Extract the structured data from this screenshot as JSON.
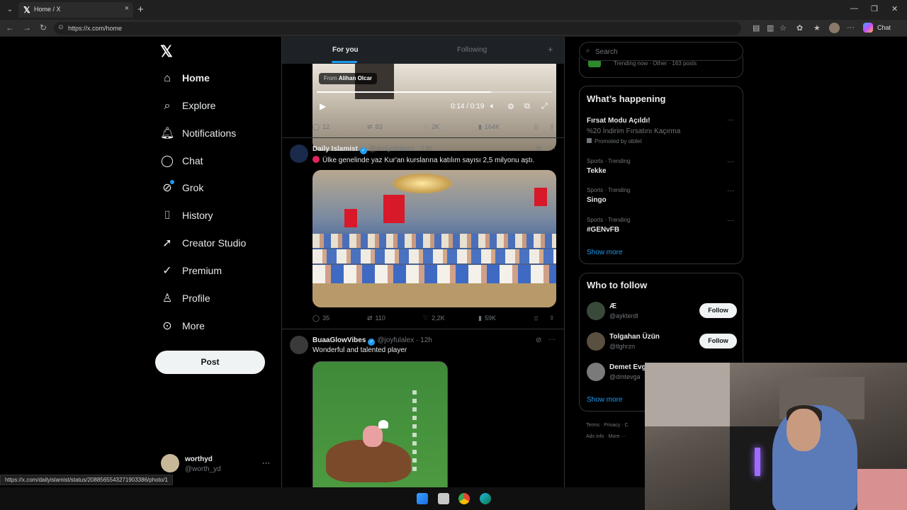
{
  "browser": {
    "tab_title": "Home / X",
    "url": "https://x.com/home",
    "chat_label": "Chat",
    "status_url": "https://x.com/dailyislamist/status/2088565543271903386/photo/1"
  },
  "nav": {
    "logo": "X",
    "items": [
      {
        "label": "Home",
        "icon": "home-icon"
      },
      {
        "label": "Explore",
        "icon": "search-icon"
      },
      {
        "label": "Notifications",
        "icon": "bell-icon"
      },
      {
        "label": "Chat",
        "icon": "chat-bubble-icon"
      },
      {
        "label": "Grok",
        "icon": "grok-icon"
      },
      {
        "label": "History",
        "icon": "bookmark-icon"
      },
      {
        "label": "Creator Studio",
        "icon": "rocket-icon"
      },
      {
        "label": "Premium",
        "icon": "verified-icon"
      },
      {
        "label": "Profile",
        "icon": "person-icon"
      },
      {
        "label": "More",
        "icon": "more-circle-icon"
      }
    ],
    "post_label": "Post",
    "account": {
      "name": "worthyd",
      "handle": "@worth_yd"
    }
  },
  "feed": {
    "tabs": {
      "for_you": "For you",
      "following": "Following"
    },
    "video": {
      "from_prefix": "From",
      "from_name": "Alihan Olcar",
      "time": "0:14 / 0:19",
      "progress": 0.74
    },
    "tweet0_stats": {
      "replies": "12",
      "reposts": "83",
      "likes": "2K",
      "views": "164K"
    },
    "tweet1": {
      "name": "Daily Islamist",
      "handle": "@dailyislamist",
      "time": "· 14h",
      "text": "Ülke genelinde yaz Kur'an kurslarına katılım sayısı 2,5 milyonu aştı.",
      "stats": {
        "replies": "35",
        "reposts": "110",
        "likes": "2,2K",
        "views": "59K"
      }
    },
    "tweet2": {
      "name": "BuaaGlowVibes",
      "handle": "@joyfulalex",
      "time": "· 12h",
      "text": "Wonderful and talented player"
    }
  },
  "sidebar": {
    "search_placeholder": "Search",
    "partial_trend": "Trending now · Other · 163 posts",
    "happening": {
      "title": "What’s happening",
      "trends": [
        {
          "meta": "",
          "name": "Fırsat Modu Açıldı!",
          "desc": "%20 İndirim Fırsatını Kaçırma",
          "promo": "Promoted by obilet"
        },
        {
          "meta": "Sports · Trending",
          "name": "Tekke"
        },
        {
          "meta": "Sports · Trending",
          "name": "Singo"
        },
        {
          "meta": "Sports · Trending",
          "name": "#GENvFB"
        }
      ],
      "show_more": "Show more"
    },
    "who_to_follow": {
      "title": "Who to follow",
      "users": [
        {
          "name": "Æ",
          "handle": "@aykterdl",
          "button": "Follow"
        },
        {
          "name": "Tolgahan Üzün",
          "handle": "@tlghrzn",
          "button": "Follow"
        },
        {
          "name": "Demet Evg",
          "handle": "@dmtevga"
        }
      ],
      "show_more": "Show more"
    },
    "footer": {
      "line1": "Terms  ·  Privacy  ·  C",
      "line2": "Ads info  ·  More ···"
    }
  },
  "colors": {
    "accent": "#1d9bf0",
    "background": "#000000",
    "border": "#2f3336",
    "muted": "#71767b"
  }
}
